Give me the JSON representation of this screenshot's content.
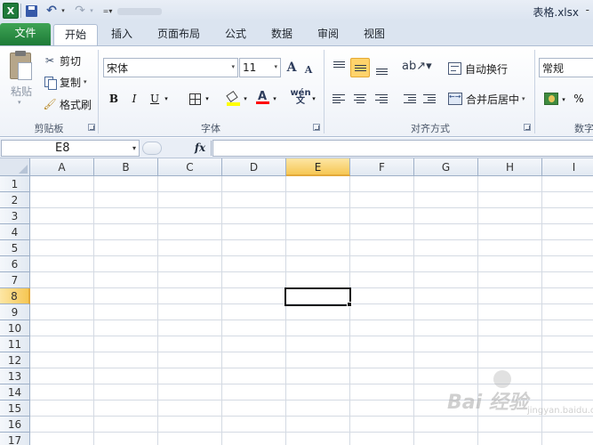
{
  "window": {
    "title": "表格.xlsx",
    "more": "-"
  },
  "quick_access": {
    "app_icon": "X",
    "undo_icon": "↶",
    "redo_icon": "↷",
    "dropdown": "▾",
    "custom": "=▾"
  },
  "tabs": [
    {
      "label": "文件"
    },
    {
      "label": "开始"
    },
    {
      "label": "插入"
    },
    {
      "label": "页面布局"
    },
    {
      "label": "公式"
    },
    {
      "label": "数据"
    },
    {
      "label": "审阅"
    },
    {
      "label": "视图"
    }
  ],
  "clipboard": {
    "paste_label": "粘贴",
    "cut_label": "剪切",
    "copy_label": "复制",
    "format_painter_label": "格式刷",
    "group_label": "剪贴板"
  },
  "font": {
    "name": "宋体",
    "size": "11",
    "grow": "A",
    "shrink": "A",
    "bold": "B",
    "italic": "I",
    "underline": "U",
    "color_letter": "A",
    "phonetic": "wén\n文",
    "group_label": "字体",
    "fill_color": "#ffff00",
    "font_color": "#ff0000"
  },
  "alignment": {
    "wrap_label": "自动换行",
    "merge_label": "合并后居中",
    "group_label": "对齐方式"
  },
  "number": {
    "format": "常规",
    "percent": "%",
    "group_label": "数字"
  },
  "formula_bar": {
    "name_box": "E8",
    "fx": "fx",
    "value": ""
  },
  "sheet": {
    "columns": [
      "A",
      "B",
      "C",
      "D",
      "E",
      "F",
      "G",
      "H",
      "I"
    ],
    "rows": [
      "1",
      "2",
      "3",
      "4",
      "5",
      "6",
      "7",
      "8",
      "9",
      "10",
      "11",
      "12",
      "13",
      "14",
      "15",
      "16",
      "17"
    ],
    "selected_column": "E",
    "selected_row": "8"
  },
  "watermark": {
    "text": "Bai 经验",
    "sub": "jingyan.baidu.com"
  }
}
